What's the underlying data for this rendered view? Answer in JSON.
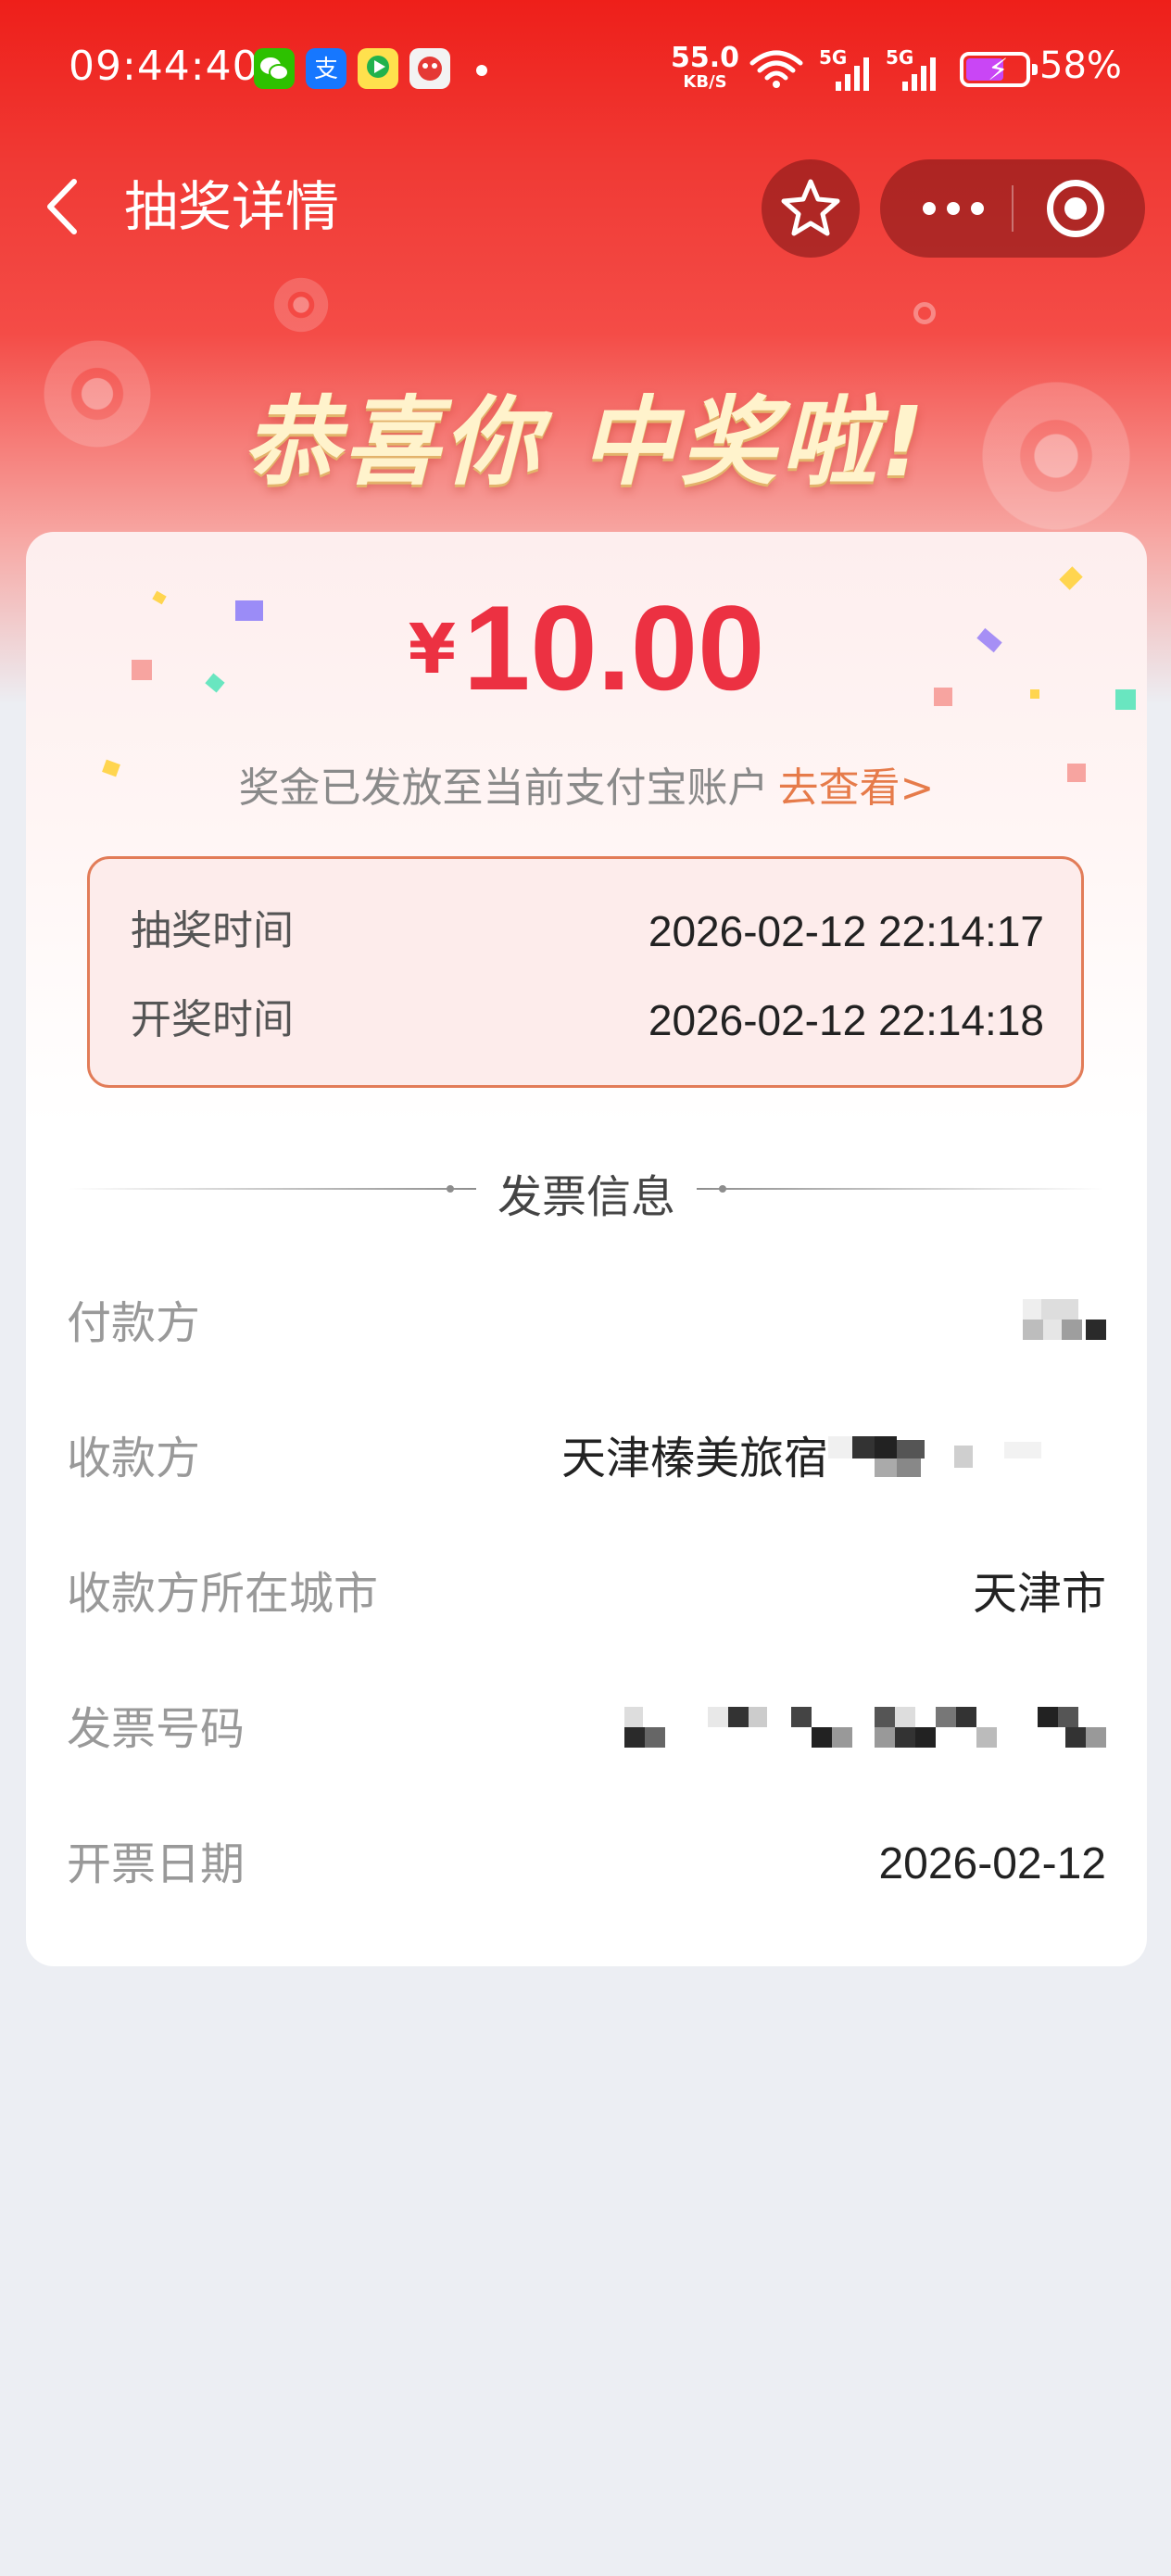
{
  "status_bar": {
    "time": "09:44:40",
    "net_speed_value": "55.0",
    "net_speed_unit": "KB/S",
    "sim1_label": "5G",
    "sim2_label": "5G",
    "battery_percent": "58%",
    "app_icons": [
      "wechat-icon",
      "alipay-icon",
      "video-app-icon",
      "game-app-icon"
    ]
  },
  "nav": {
    "title": "抽奖详情",
    "back_icon": "chevron-left-icon",
    "favorite_icon": "star-icon",
    "more_icon": "more-dots-icon",
    "close_icon": "target-close-icon"
  },
  "hero": {
    "congrats": "恭喜你 中奖啦!"
  },
  "prize": {
    "currency": "¥",
    "amount": "10.00",
    "notice": "奖金已发放至当前支付宝账户",
    "notice_link": "去查看>"
  },
  "times": {
    "draw_label": "抽奖时间",
    "draw_value": "2026-02-12 22:14:17",
    "reveal_label": "开奖时间",
    "reveal_value": "2026-02-12 22:14:18"
  },
  "invoice": {
    "section_title": "发票信息",
    "rows": [
      {
        "label": "付款方",
        "value": ""
      },
      {
        "label": "收款方",
        "value": "天津榛美旅宿"
      },
      {
        "label": "收款方所在城市",
        "value": "天津市"
      },
      {
        "label": "发票号码",
        "value": ""
      },
      {
        "label": "开票日期",
        "value": "2026-02-12"
      }
    ]
  },
  "colors": {
    "hero_red": "#ee1f1a",
    "amount_red": "#ec3142",
    "link_orange": "#e67b4a",
    "box_border": "#e27c58",
    "page_bg": "#eceef3"
  }
}
